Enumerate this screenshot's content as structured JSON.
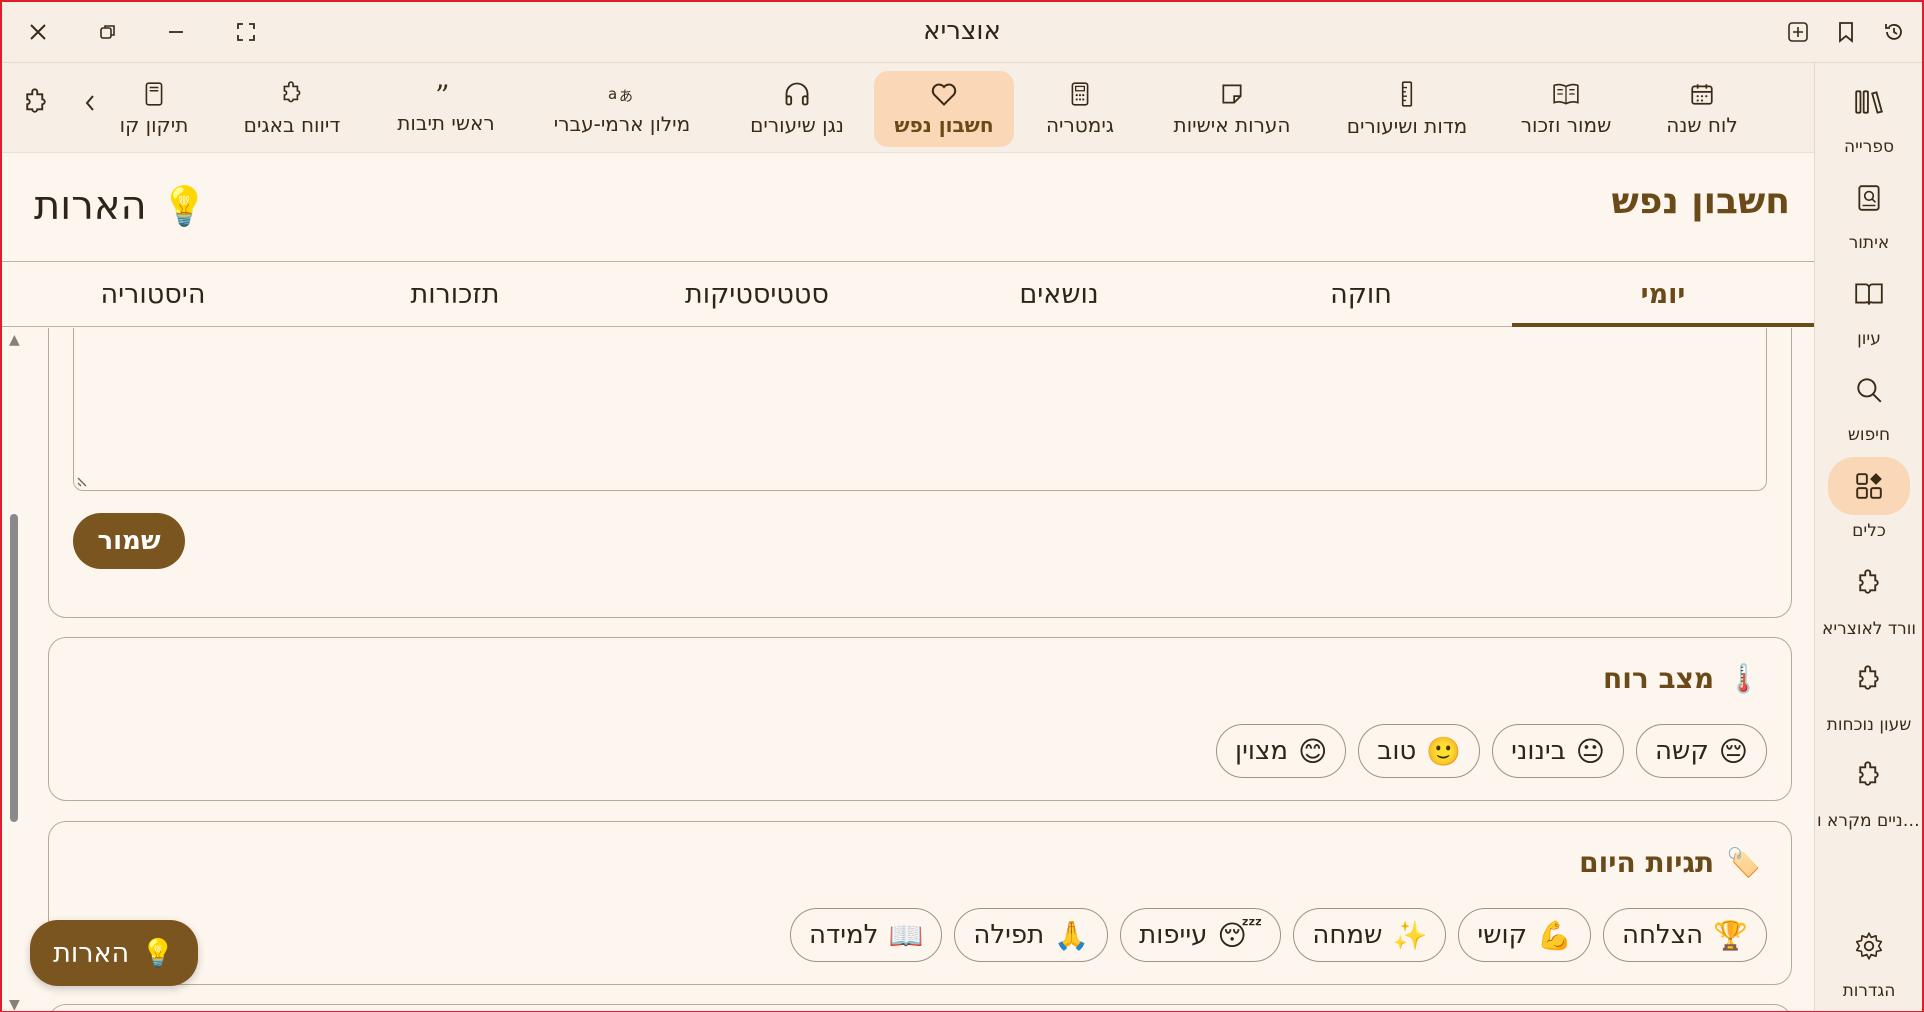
{
  "window": {
    "title": "אוצריא"
  },
  "rail": {
    "items": [
      {
        "label": "ספרייה",
        "icon": "library-icon"
      },
      {
        "label": "איתור",
        "icon": "find-book-icon"
      },
      {
        "label": "עיון",
        "icon": "open-book-icon"
      },
      {
        "label": "חיפוש",
        "icon": "search-icon"
      },
      {
        "label": "כלים",
        "icon": "tools-grid-icon",
        "active": true
      },
      {
        "label": "וורד לאוצריא",
        "icon": "puzzle-icon"
      },
      {
        "label": "שעון נוכחות",
        "icon": "puzzle-icon"
      },
      {
        "label": "שניים מקרא ו...",
        "icon": "puzzle-icon"
      },
      {
        "label": "הגדרות",
        "icon": "gear-icon"
      }
    ]
  },
  "toolbar": {
    "tools": [
      {
        "label": "לוח שנה",
        "icon": "calendar-icon"
      },
      {
        "label": "שמור וזכור",
        "icon": "book-icon"
      },
      {
        "label": "מדות ושיעורים",
        "icon": "ruler-icon"
      },
      {
        "label": "הערות אישיות",
        "icon": "note-icon"
      },
      {
        "label": "גימטריה",
        "icon": "calculator-icon"
      },
      {
        "label": "חשבון נפש",
        "icon": "heart-icon",
        "active": true
      },
      {
        "label": "נגן שיעורים",
        "icon": "headphones-icon"
      },
      {
        "label": "מילון ארמי-עברי",
        "icon": "translate-icon"
      },
      {
        "label": "ראשי תיבות",
        "icon": "quote-icon"
      },
      {
        "label": "דיווח באגים",
        "icon": "puzzle-icon"
      },
      {
        "label": "תיקון קו",
        "icon": "tablet-icon"
      }
    ]
  },
  "panel": {
    "title": "חשבון נפש",
    "notes_link": "הארות",
    "notes_emoji": "💡"
  },
  "tabs": [
    {
      "label": "יומי",
      "active": true
    },
    {
      "label": "חוקה"
    },
    {
      "label": "נושאים"
    },
    {
      "label": "סטטיסטיקות"
    },
    {
      "label": "תזכורות"
    },
    {
      "label": "היסטוריה"
    }
  ],
  "journal": {
    "save_label": "שמור"
  },
  "mood": {
    "title": "מצב רוח",
    "emoji": "🌡️",
    "options": [
      {
        "emoji": "😔",
        "label": "קשה"
      },
      {
        "emoji": "😐",
        "label": "בינוני"
      },
      {
        "emoji": "🙂",
        "label": "טוב"
      },
      {
        "emoji": "😊",
        "label": "מצוין"
      }
    ]
  },
  "tags": {
    "title": "תגיות היום",
    "emoji": "🏷️",
    "options": [
      {
        "emoji": "🏆",
        "label": "הצלחה"
      },
      {
        "emoji": "💪",
        "label": "קושי"
      },
      {
        "emoji": "✨",
        "label": "שמחה"
      },
      {
        "emoji": "😴",
        "label": "עייפות"
      },
      {
        "emoji": "🙏",
        "label": "תפילה"
      },
      {
        "emoji": "📖",
        "label": "למידה"
      }
    ]
  },
  "fab": {
    "label": "הארות",
    "emoji": "💡"
  },
  "colors": {
    "accent": "#7b5520",
    "accent_text": "#6b4a1a",
    "active_bg": "#f9d7b7",
    "background": "#fdf6ee"
  }
}
